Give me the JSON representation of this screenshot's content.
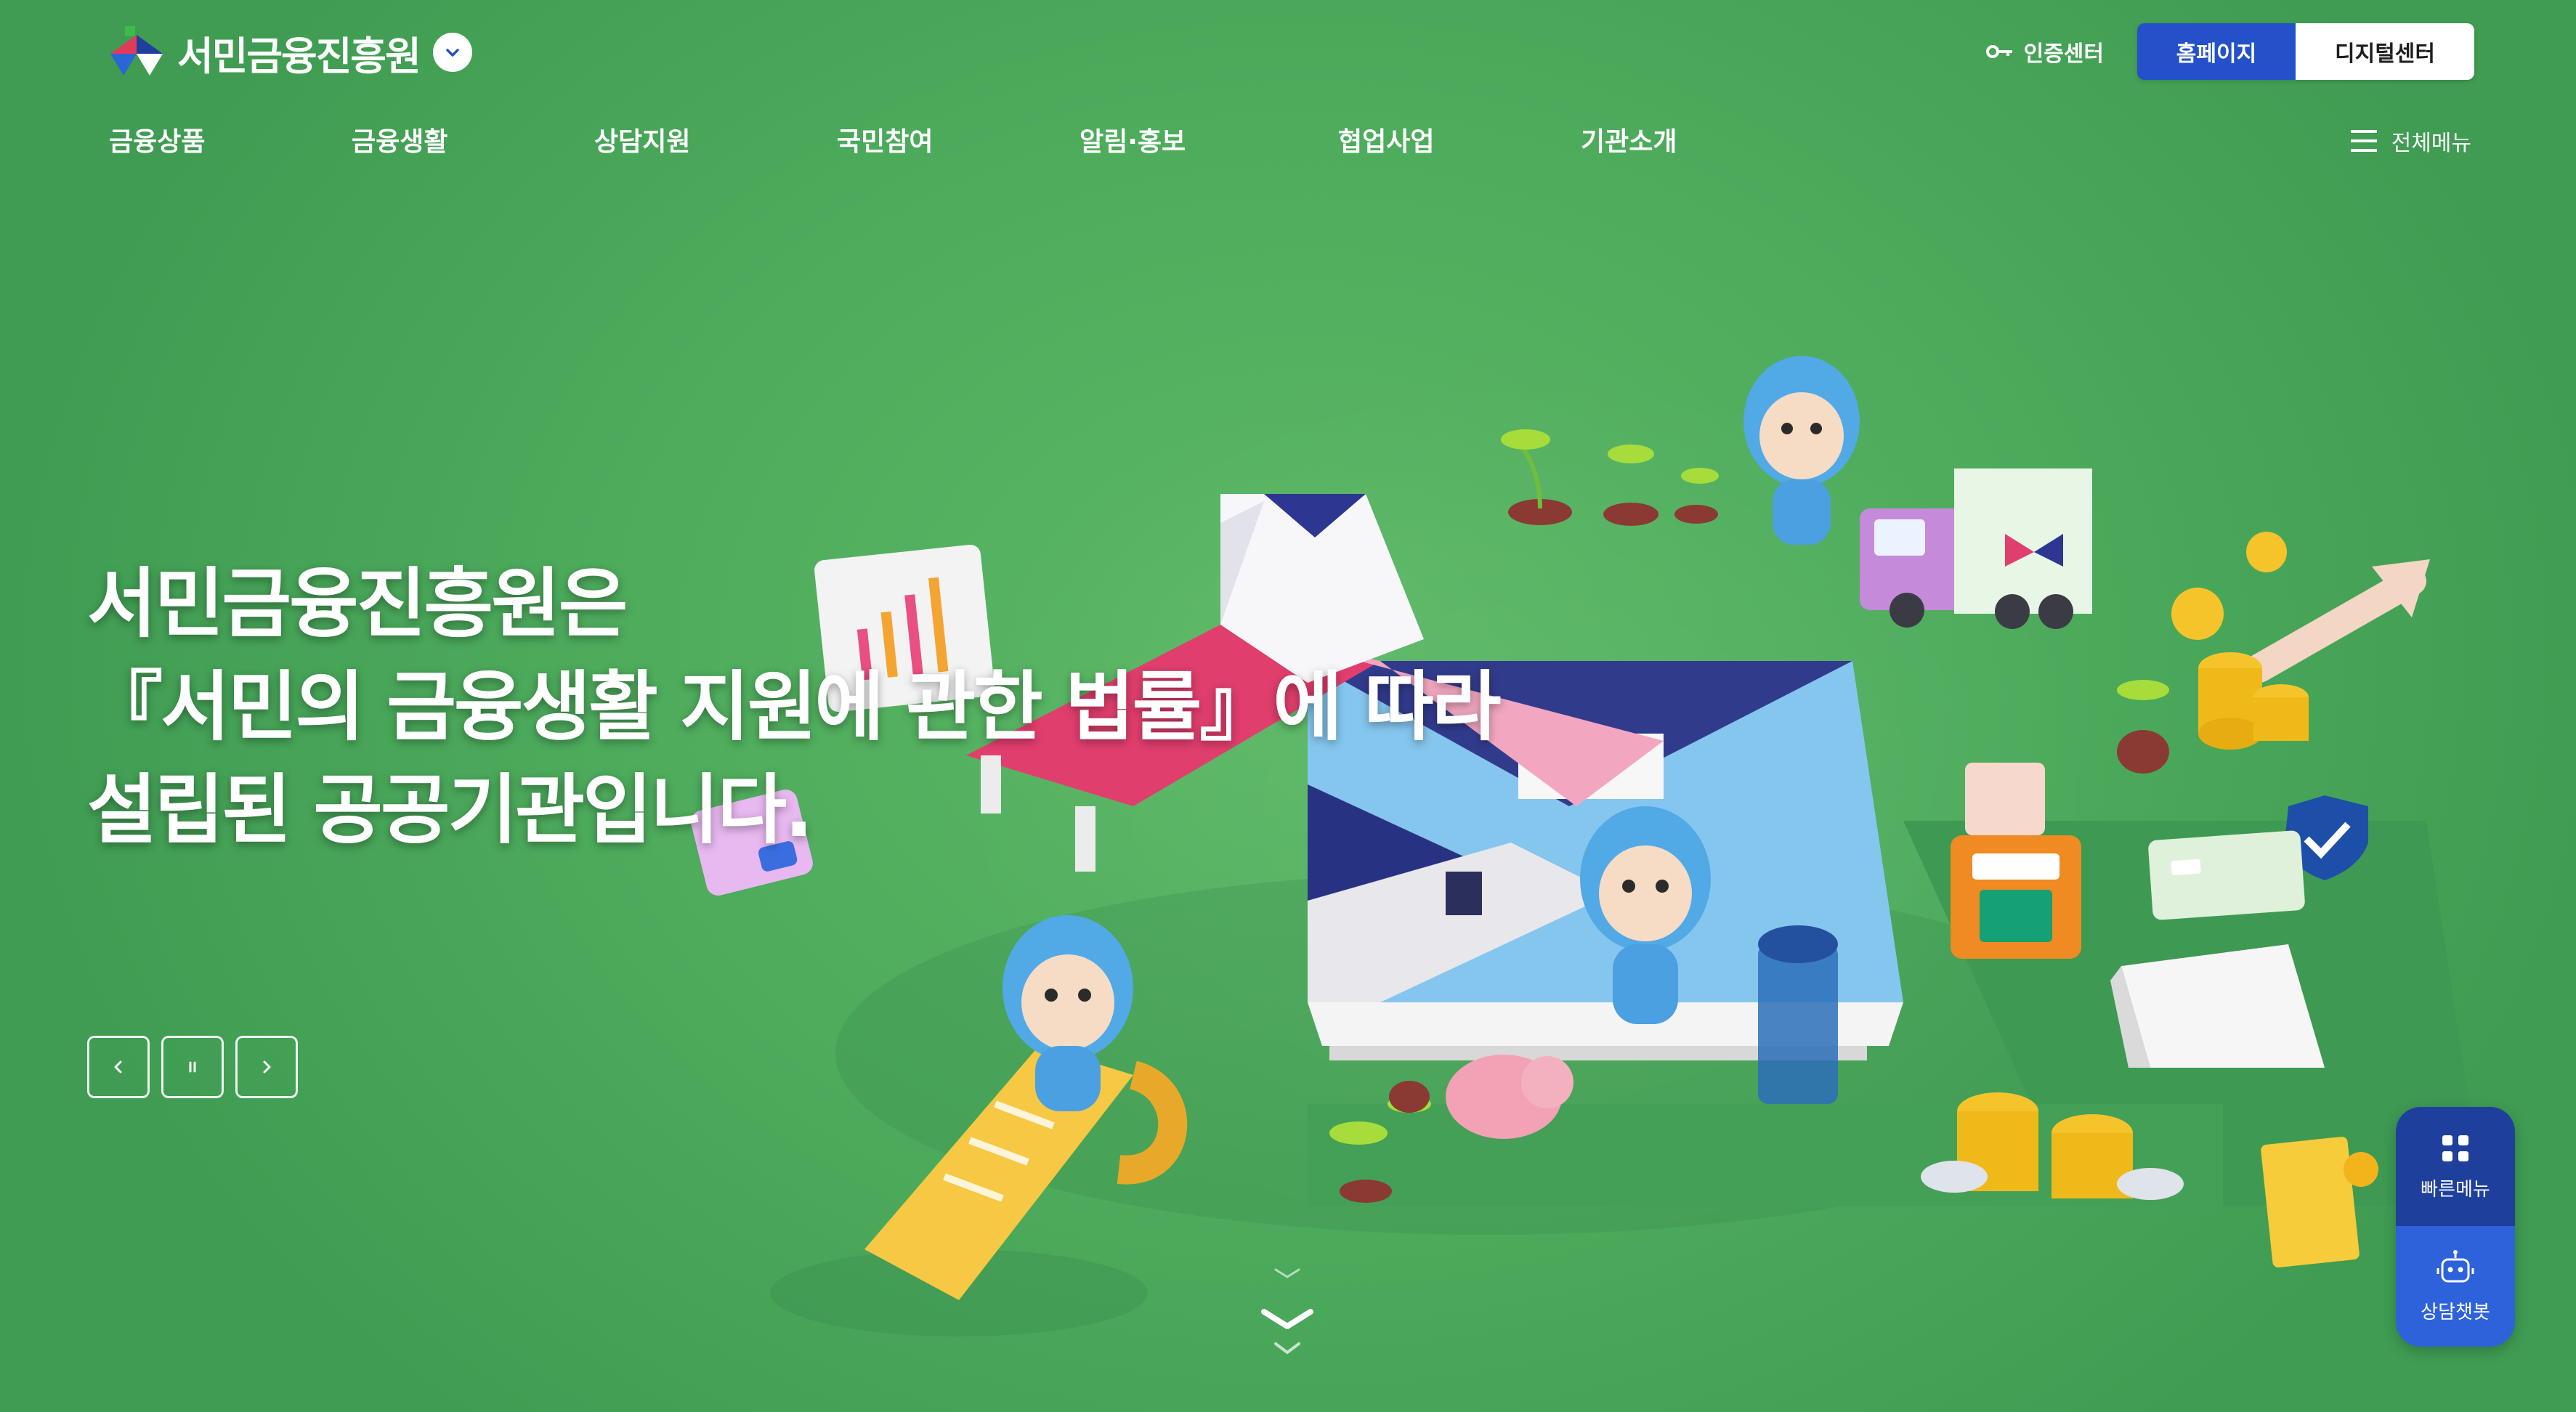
{
  "header": {
    "logo_text": "서민금융진흥원",
    "auth_center": "인증센터",
    "site_switch": {
      "homepage": "홈페이지",
      "digital": "디지털센터"
    },
    "all_menu": "전체메뉴"
  },
  "gnb": [
    "금융상품",
    "금융생활",
    "상담지원",
    "국민참여",
    "알림·홍보",
    "협업사업",
    "기관소개"
  ],
  "hero": {
    "title_line1": "서민금융진흥원은",
    "title_line2": "『서민의 금융생활 지원에 관한 법률』에 따라",
    "title_line3": "설립된 공공기관입니다."
  },
  "quick_menu": {
    "quick": "빠른메뉴",
    "chatbot": "상담챗봇"
  },
  "colors": {
    "background": "#4cab5c",
    "primary": "#2451c9",
    "quick_dark": "#1f3f9c",
    "quick_light": "#2e62db"
  },
  "icons": [
    "logo-mark-icon",
    "chevron-down-icon",
    "key-icon",
    "hamburger-icon",
    "prev-icon",
    "pause-icon",
    "next-icon",
    "scroll-down-icon",
    "grid-icon",
    "robot-icon"
  ]
}
